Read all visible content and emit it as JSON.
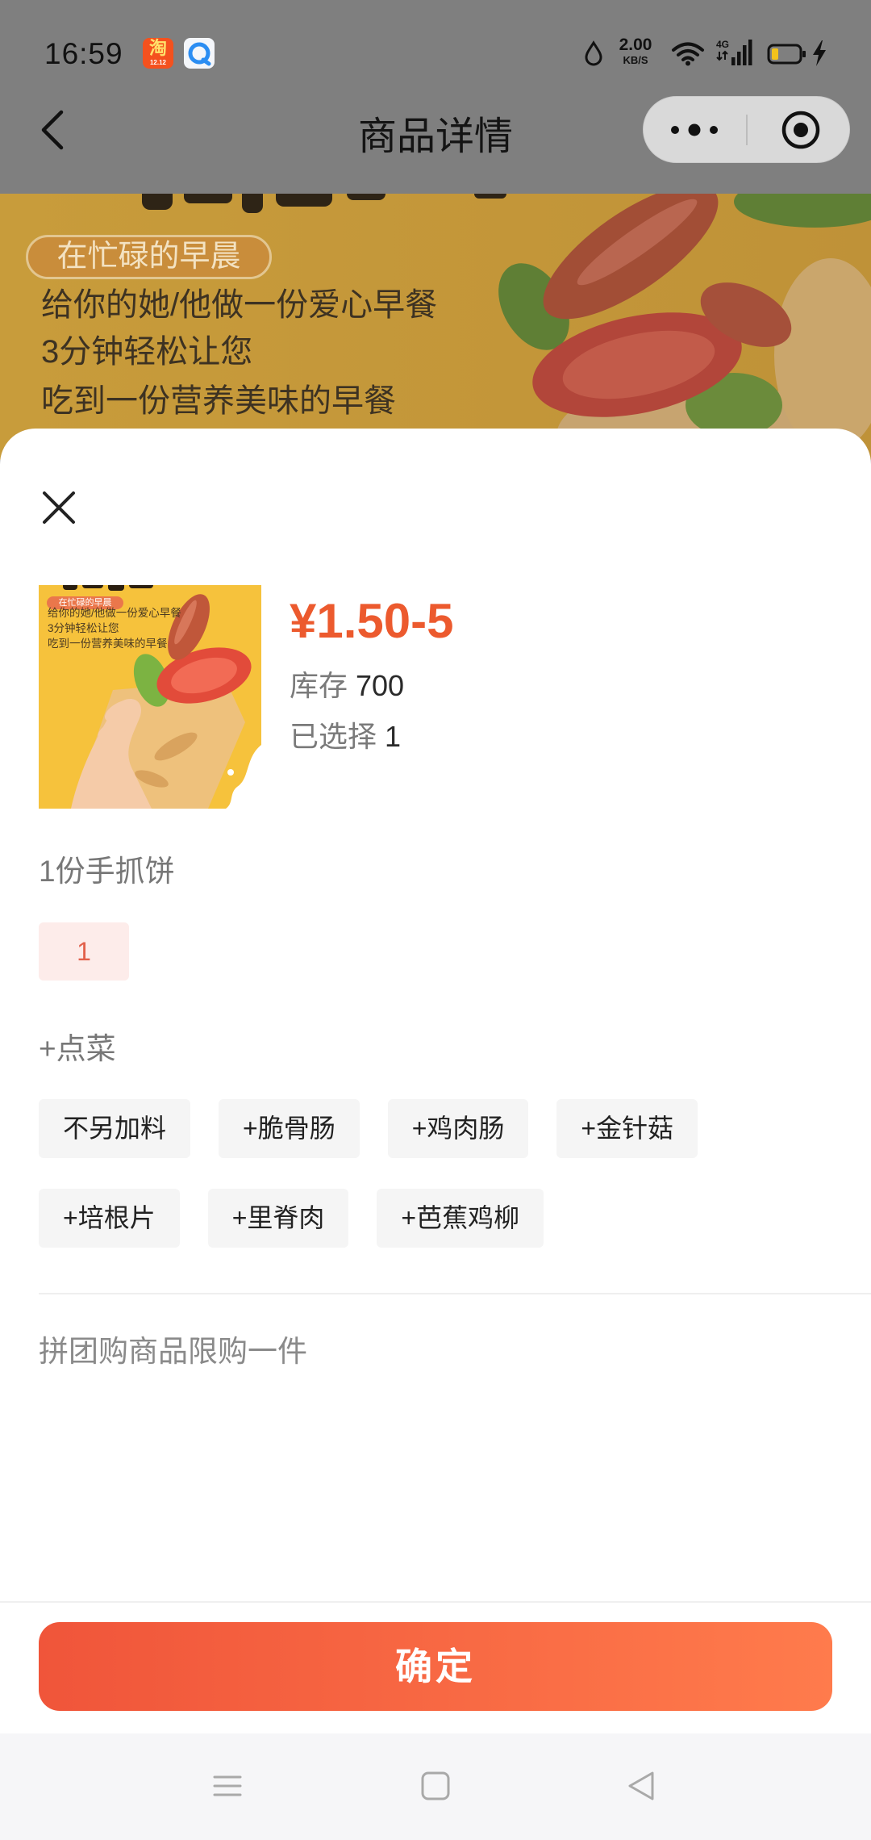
{
  "status_bar": {
    "time": "16:59",
    "apps": [
      {
        "icon": "taobao-app-icon",
        "logo_text": "淘",
        "logo_subtext": "12.12"
      },
      {
        "icon": "browser-app-icon"
      }
    ],
    "icons": [
      "water-drop-icon",
      "wifi-icon",
      "cellular-signal-icon",
      "battery-icon",
      "charging-icon"
    ],
    "net_speed_value": "2.00",
    "net_speed_unit": "KB/S",
    "network": "4G",
    "battery_level": 0.25
  },
  "nav": {
    "title": "商品详情",
    "back_icon": "chevron-left-icon",
    "capsule": {
      "more_icon": "more-dots-icon",
      "close_icon": "target-circle-icon"
    }
  },
  "banner": {
    "tag": "在忙碌的早晨",
    "lines": [
      "给你的她/他做一份爱心早餐",
      "3分钟轻松让您",
      "吃到一份营养美味的早餐"
    ]
  },
  "sheet": {
    "close_icon": "close-icon",
    "product": {
      "thumbnail": {
        "tag": "在忙碌的早晨",
        "lines": [
          "给你的她/他做一份爱心早餐",
          "3分钟轻松让您",
          "吃到一份营养美味的早餐"
        ]
      },
      "price": "¥1.50-5",
      "stock_label": "库存",
      "stock_value": "700",
      "selected_label": "已选择",
      "selected_value": "1"
    },
    "spec_groups": [
      {
        "title": "1份手抓饼",
        "options": [
          {
            "label": "1",
            "selected": true
          }
        ]
      },
      {
        "title": "+点菜",
        "options": [
          {
            "label": "不另加料",
            "selected": false
          },
          {
            "label": "+脆骨肠",
            "selected": false
          },
          {
            "label": "+鸡肉肠",
            "selected": false
          },
          {
            "label": "+金针菇",
            "selected": false
          },
          {
            "label": "+培根片",
            "selected": false
          },
          {
            "label": "+里脊肉",
            "selected": false
          },
          {
            "label": "+芭蕉鸡柳",
            "selected": false
          }
        ]
      }
    ],
    "notice": "拼团购商品限购一件",
    "confirm_label": "确定"
  },
  "system_nav": {
    "icons": [
      "menu-icon",
      "home-square-icon",
      "back-triangle-icon"
    ]
  },
  "colors": {
    "accent": "#ec5a2e",
    "button_start": "#f0553a",
    "button_end": "#ff7b4c",
    "chip_bg": "#f5f5f5",
    "chip_selected_bg": "#fdecea",
    "overlay_gray": "#7f7f7f"
  }
}
